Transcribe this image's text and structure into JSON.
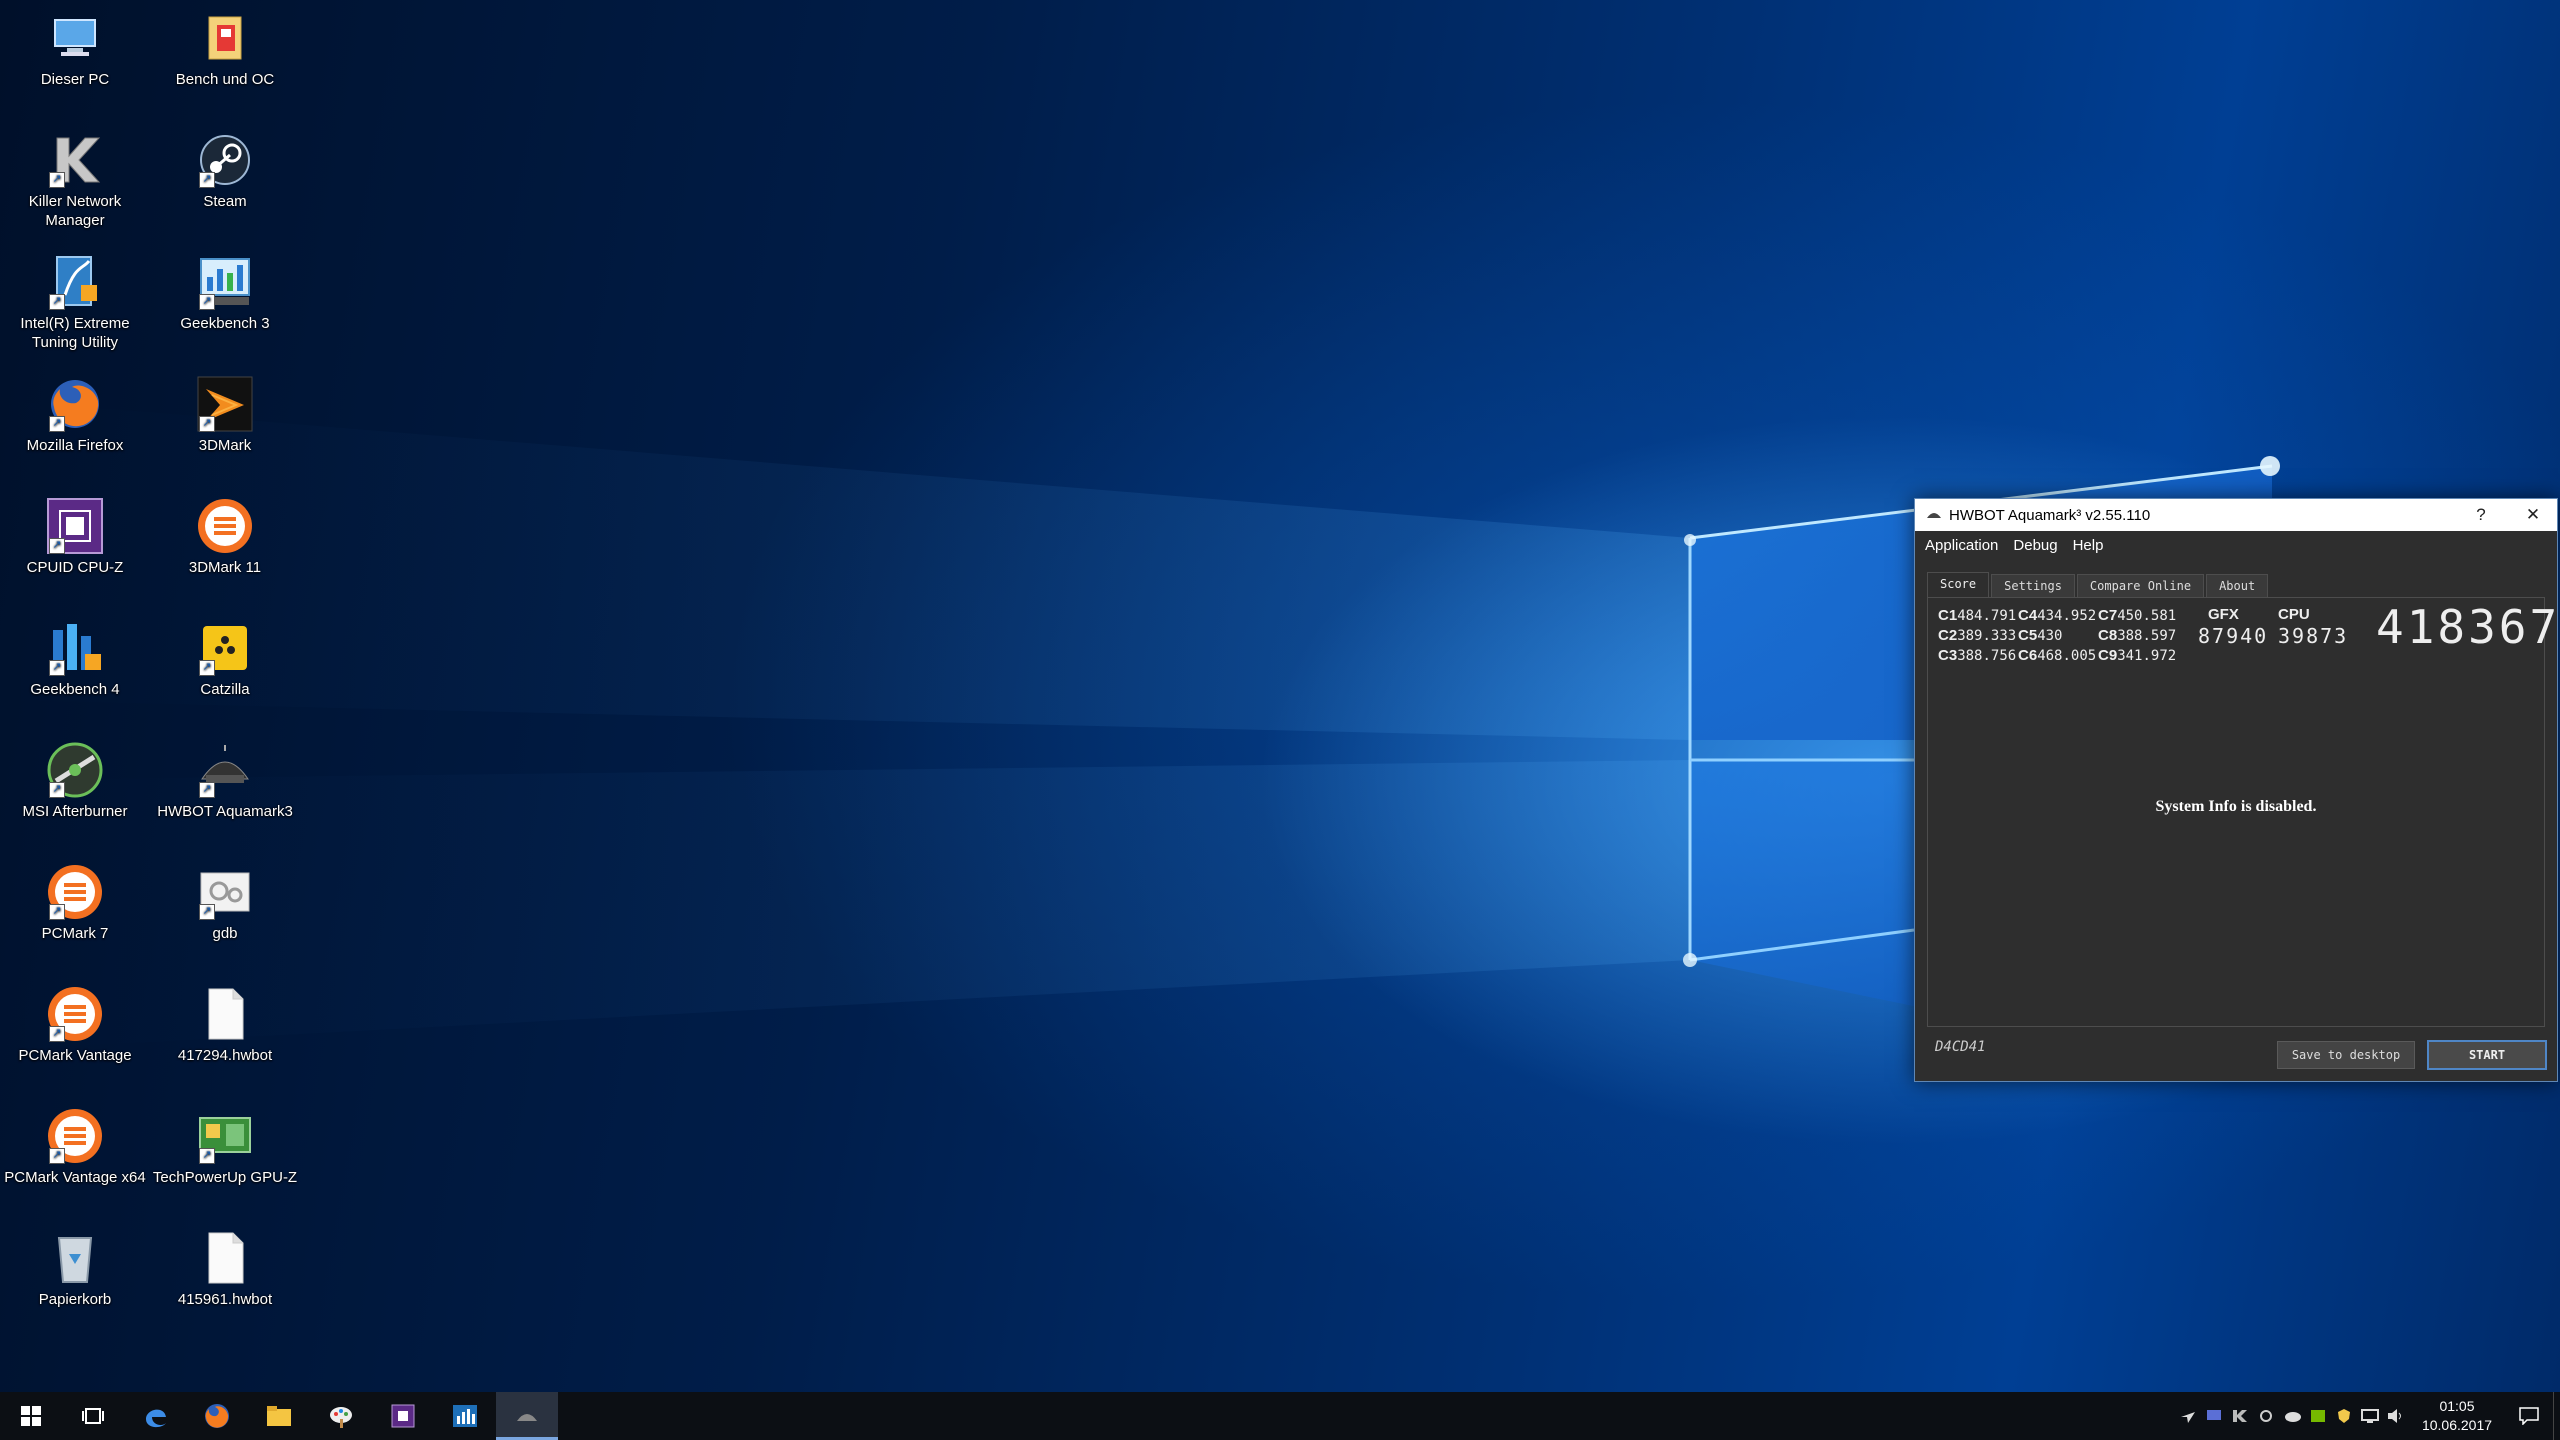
{
  "desktop": {
    "icons": [
      {
        "label": "Dieser PC",
        "icon": "computer-icon"
      },
      {
        "label": "Bench und OC",
        "icon": "folder-icon"
      },
      {
        "label": "Killer Network Manager",
        "icon": "killer-k-icon"
      },
      {
        "label": "Steam",
        "icon": "steam-icon"
      },
      {
        "label": "Intel(R) Extreme Tuning Utility",
        "icon": "intel-xtu-icon"
      },
      {
        "label": "Geekbench 3",
        "icon": "geekbench3-icon"
      },
      {
        "label": "Mozilla Firefox",
        "icon": "firefox-icon"
      },
      {
        "label": "3DMark",
        "icon": "3dmark-icon"
      },
      {
        "label": "CPUID CPU-Z",
        "icon": "cpuz-icon"
      },
      {
        "label": "3DMark 11",
        "icon": "3dmark11-icon"
      },
      {
        "label": "Geekbench 4",
        "icon": "geekbench4-icon"
      },
      {
        "label": "Catzilla",
        "icon": "catzilla-icon"
      },
      {
        "label": "MSI Afterburner",
        "icon": "afterburner-icon"
      },
      {
        "label": "HWBOT Aquamark3",
        "icon": "aquamark-icon"
      },
      {
        "label": "PCMark 7",
        "icon": "pcmark-icon"
      },
      {
        "label": "gdb",
        "icon": "settings-file-icon"
      },
      {
        "label": "PCMark Vantage",
        "icon": "pcmark-icon"
      },
      {
        "label": "417294.hwbot",
        "icon": "file-icon"
      },
      {
        "label": "PCMark Vantage x64",
        "icon": "pcmark-icon"
      },
      {
        "label": "TechPowerUp GPU-Z",
        "icon": "gpuz-icon"
      },
      {
        "label": "Papierkorb",
        "icon": "recycle-bin-icon"
      },
      {
        "label": "415961.hwbot",
        "icon": "file-icon"
      }
    ]
  },
  "window": {
    "title": "HWBOT Aquamark³ v2.55.110",
    "help_label": "?",
    "close_label": "✕",
    "menu": [
      "Application",
      "Debug",
      "Help"
    ],
    "tabs": [
      "Score",
      "Settings",
      "Compare Online",
      "About"
    ],
    "active_tab": "Score",
    "scores": [
      {
        "label": "C1",
        "value": "484.791"
      },
      {
        "label": "C2",
        "value": "389.333"
      },
      {
        "label": "C3",
        "value": "388.756"
      },
      {
        "label": "C4",
        "value": "434.952"
      },
      {
        "label": "C5",
        "value": "430"
      },
      {
        "label": "C6",
        "value": "468.005"
      },
      {
        "label": "C7",
        "value": "450.581"
      },
      {
        "label": "C8",
        "value": "388.597"
      },
      {
        "label": "C9",
        "value": "341.972"
      }
    ],
    "gfx_label": "GFX",
    "gfx_value": "87940",
    "cpu_label": "CPU",
    "cpu_value": "39873",
    "total_score": "418367",
    "system_info": "System Info is disabled.",
    "code": "D4CD41",
    "save_button": "Save to desktop",
    "start_button": "START"
  },
  "taskbar": {
    "items": [
      "start-icon",
      "task-view-icon",
      "edge-icon",
      "firefox-icon",
      "file-explorer-icon",
      "paint-icon",
      "cpuz-icon",
      "xtu-icon",
      "aquamark-icon"
    ],
    "active_item": "aquamark-icon",
    "time": "01:05",
    "date": "10.06.2017"
  }
}
